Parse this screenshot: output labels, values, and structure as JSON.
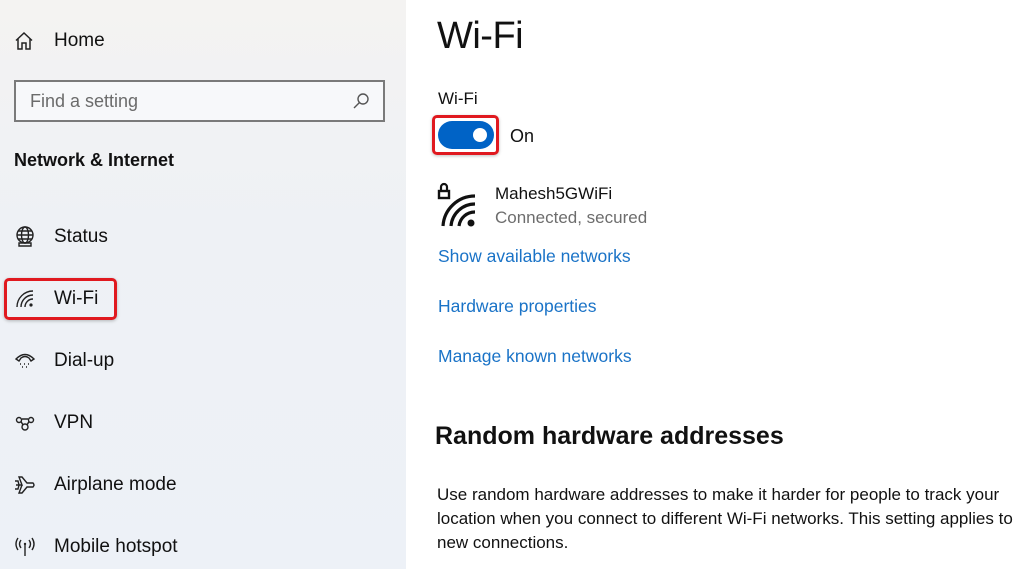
{
  "sidebar": {
    "home_label": "Home",
    "search": {
      "placeholder": "Find a setting",
      "value": ""
    },
    "section_title": "Network & Internet",
    "items": [
      {
        "label": "Status",
        "icon": "globe-status-icon"
      },
      {
        "label": "Wi-Fi",
        "icon": "wifi-icon",
        "selected": true,
        "highlighted": true
      },
      {
        "label": "Dial-up",
        "icon": "dialup-phone-icon"
      },
      {
        "label": "VPN",
        "icon": "vpn-icon"
      },
      {
        "label": "Airplane mode",
        "icon": "airplane-icon"
      },
      {
        "label": "Mobile hotspot",
        "icon": "hotspot-icon"
      }
    ]
  },
  "main": {
    "title": "Wi-Fi",
    "wifi_toggle": {
      "label": "Wi-Fi",
      "state_text": "On",
      "on": true,
      "highlighted": true
    },
    "network": {
      "name": "Mahesh5GWiFi",
      "status": "Connected, secured",
      "icon": "wifi-secured-icon"
    },
    "links": [
      {
        "label": "Show available networks"
      },
      {
        "label": "Hardware properties"
      },
      {
        "label": "Manage known networks"
      }
    ],
    "random_hw": {
      "heading": "Random hardware addresses",
      "description": "Use random hardware addresses to make it harder for people to track your location when you connect to different Wi-Fi networks. This setting applies to new connections."
    }
  },
  "colors": {
    "accent": "#0063c6",
    "link": "#1a73c7",
    "highlight": "#e0191f",
    "sidebar_bg": "#eef1f5"
  }
}
